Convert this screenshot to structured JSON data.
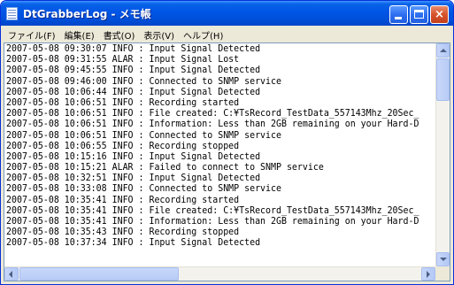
{
  "window": {
    "title": "DtGrabberLog - メモ帳",
    "minimize_label": "minimize",
    "maximize_label": "maximize",
    "close_glyph": "×"
  },
  "menu": {
    "items": [
      {
        "label": "ファイル(F)"
      },
      {
        "label": "編集(E)"
      },
      {
        "label": "書式(O)"
      },
      {
        "label": "表示(V)"
      },
      {
        "label": "ヘルプ(H)"
      }
    ]
  },
  "document": {
    "lines": [
      "2007-05-08 09:30:07 INFO : Input Signal Detected",
      "2007-05-08 09:31:55 ALAR : Input Signal Lost",
      "2007-05-08 09:45:55 INFO : Input Signal Detected",
      "2007-05-08 09:46:00 INFO : Connected to SNMP service",
      "2007-05-08 10:06:44 INFO : Input Signal Detected",
      "2007-05-08 10:06:51 INFO : Recording started",
      "2007-05-08 10:06:51 INFO : File created: C:¥TsRecord_TestData_557143Mhz_20Sec_",
      "2007-05-08 10:06:51 INFO : Information: Less than 2GB remaining on your Hard-D",
      "2007-05-08 10:06:51 INFO : Connected to SNMP service",
      "2007-05-08 10:06:55 INFO : Recording stopped",
      "2007-05-08 10:15:16 INFO : Input Signal Detected",
      "2007-05-08 10:15:21 ALAR : Failed to connect to SNMP service",
      "2007-05-08 10:32:51 INFO : Input Signal Detected",
      "2007-05-08 10:33:08 INFO : Connected to SNMP service",
      "2007-05-08 10:35:41 INFO : Recording started",
      "2007-05-08 10:35:41 INFO : File created: C:¥TsRecord_TestData_557143Mhz_20Sec_",
      "2007-05-08 10:35:41 INFO : Information: Less than 2GB remaining on your Hard-D",
      "2007-05-08 10:35:43 INFO : Recording stopped",
      "2007-05-08 10:37:34 INFO : Input Signal Detected"
    ]
  },
  "colors": {
    "titlebar": "#0055e5",
    "close_button": "#d6532c",
    "window_frame": "#ece9d8",
    "text_background": "#ffffff"
  },
  "icons": {
    "app": "notepad-icon",
    "scroll_up": "arrow-up-icon",
    "scroll_down": "arrow-down-icon",
    "scroll_left": "arrow-left-icon",
    "scroll_right": "arrow-right-icon"
  }
}
